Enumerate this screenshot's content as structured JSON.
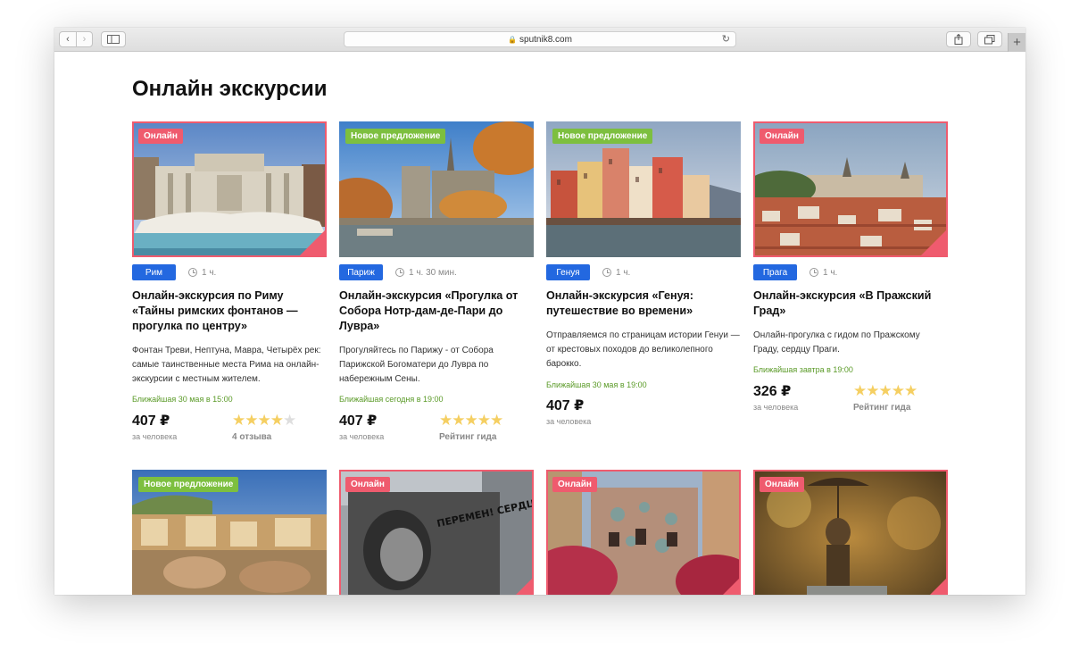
{
  "browser": {
    "url": "sputnik8.com"
  },
  "page": {
    "title": "Онлайн экскурсии"
  },
  "cards": [
    {
      "badge": "Онлайн",
      "city": "Рим",
      "duration": "1 ч.",
      "title": "Онлайн-экскурсия по Риму «Тайны римских фонтанов — прогулка по центру»",
      "description": "Фонтан Треви, Нептуна, Мавра, Четырёх рек: самые таинственные места Рима на онлайн-экскурсии с местным жителем.",
      "next_date": "Ближайшая 30 мая в 15:00",
      "price": "407 ₽",
      "per_person": "за человека",
      "rating": 4,
      "rating_label": "4 отзыва"
    },
    {
      "badge": "Новое предложение",
      "city": "Париж",
      "duration": "1 ч. 30 мин.",
      "title": "Онлайн-экскурсия «Прогулка от Собора Нотр-дам-де-Пари до Лувра»",
      "description": "Прогуляйтесь по Парижу - от Собора Парижской Богоматери до Лувра по набережным Сены.",
      "next_date": "Ближайшая сегодня в 19:00",
      "price": "407 ₽",
      "per_person": "за человека",
      "rating": 5,
      "rating_label": "Рейтинг гида"
    },
    {
      "badge": "Новое предложение",
      "city": "Генуя",
      "duration": "1 ч.",
      "title": "Онлайн-экскурсия «Генуя: путешествие во времени»",
      "description": "Отправляемся по страницам истории Генуи — от крестовых походов до великолепного барокко.",
      "next_date": "Ближайшая 30 мая в 19:00",
      "price": "407 ₽",
      "per_person": "за человека"
    },
    {
      "badge": "Онлайн",
      "city": "Прага",
      "duration": "1 ч.",
      "title": "Онлайн-экскурсия «В Пражский Град»",
      "description": "Онлайн-прогулка с гидом по Пражскому Граду, сердцу Праги.",
      "next_date": "Ближайшая завтра в 19:00",
      "price": "326 ₽",
      "per_person": "за человека",
      "rating": 5,
      "rating_label": "Рейтинг гида"
    }
  ],
  "cards_row2": [
    {
      "badge": "Новое предложение"
    },
    {
      "badge": "Онлайн",
      "sign_text": "ПЕРЕМЕН! СЕРДЦА"
    },
    {
      "badge": "Онлайн"
    },
    {
      "badge": "Онлайн"
    }
  ],
  "colors": {
    "online_badge": "#ef5b6e",
    "new_badge": "#7dbf3f",
    "city_tag": "#2368e0",
    "next_date": "#5a9a27",
    "star": "#f5cf62"
  }
}
